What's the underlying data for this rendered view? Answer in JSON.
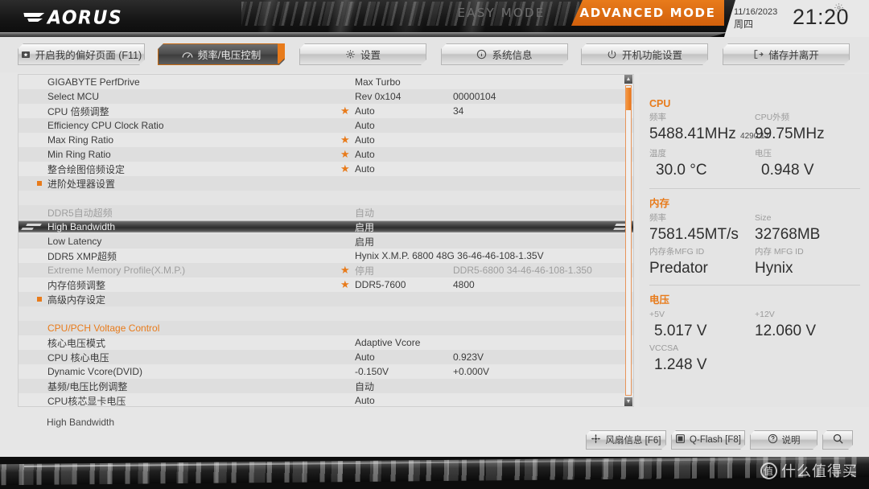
{
  "header": {
    "brand": "AORUS",
    "mode_easy": "EASY MODE",
    "mode_advanced": "ADVANCED MODE",
    "date": "11/16/2023",
    "weekday": "周四",
    "time": "21:20",
    "gear_icon": "gear-icon"
  },
  "tabs": [
    {
      "label": "开启我的偏好页面 (F11)",
      "icon": "favorite-page-icon",
      "active": false
    },
    {
      "label": "频率/电压控制",
      "icon": "tweaker-icon",
      "active": true
    },
    {
      "label": "设置",
      "icon": "gear-icon",
      "active": false
    },
    {
      "label": "系统信息",
      "icon": "info-icon",
      "active": false
    },
    {
      "label": "开机功能设置",
      "icon": "power-icon",
      "active": false
    },
    {
      "label": "储存并离开",
      "icon": "exit-icon",
      "active": false
    }
  ],
  "rows": [
    {
      "type": "item",
      "label": "GIGABYTE PerfDrive",
      "star": false,
      "value": "Max Turbo",
      "value2": "",
      "dim": false,
      "bullet": false
    },
    {
      "type": "item",
      "label": "Select MCU",
      "star": false,
      "value": "Rev 0x104",
      "value2": "00000104",
      "dim": false,
      "bullet": false
    },
    {
      "type": "item",
      "label": "CPU 倍频调整",
      "star": true,
      "value": "Auto",
      "value2": "34",
      "dim": false,
      "bullet": false
    },
    {
      "type": "item",
      "label": "Efficiency CPU Clock Ratio",
      "star": false,
      "value": "Auto",
      "value2": "",
      "dim": false,
      "bullet": false
    },
    {
      "type": "item",
      "label": "Max Ring Ratio",
      "star": true,
      "value": "Auto",
      "value2": "",
      "dim": false,
      "bullet": false
    },
    {
      "type": "item",
      "label": "Min Ring Ratio",
      "star": true,
      "value": "Auto",
      "value2": "",
      "dim": false,
      "bullet": false
    },
    {
      "type": "item",
      "label": "整合绘图倍频设定",
      "star": true,
      "value": "Auto",
      "value2": "",
      "dim": false,
      "bullet": false
    },
    {
      "type": "item",
      "label": "进阶处理器设置",
      "star": false,
      "value": "",
      "value2": "",
      "dim": false,
      "bullet": true
    },
    {
      "type": "spacer",
      "label": "",
      "star": false,
      "value": "",
      "value2": "",
      "dim": false,
      "bullet": false
    },
    {
      "type": "item",
      "label": "DDR5自动超频",
      "star": false,
      "value": "自动",
      "value2": "",
      "dim": true,
      "bullet": false
    },
    {
      "type": "selected",
      "label": "High Bandwidth",
      "star": false,
      "value": "启用",
      "value2": "",
      "dim": false,
      "bullet": false
    },
    {
      "type": "item",
      "label": "Low Latency",
      "star": false,
      "value": "启用",
      "value2": "",
      "dim": false,
      "bullet": false
    },
    {
      "type": "item",
      "label": "DDR5 XMP超频",
      "star": false,
      "value": "Hynix X.M.P. 6800 48G 36-46-46-108-1.35V",
      "value2": "",
      "dim": false,
      "bullet": false
    },
    {
      "type": "item",
      "label": "Extreme Memory Profile(X.M.P.)",
      "star": true,
      "value": "停用",
      "value2": "DDR5-6800 34-46-46-108-1.350",
      "dim": true,
      "bullet": false
    },
    {
      "type": "item",
      "label": "内存倍频调整",
      "star": true,
      "value": "DDR5-7600",
      "value2": "4800",
      "dim": false,
      "bullet": false
    },
    {
      "type": "item",
      "label": "高级内存设定",
      "star": false,
      "value": "",
      "value2": "",
      "dim": false,
      "bullet": true
    },
    {
      "type": "spacer",
      "label": "",
      "star": false,
      "value": "",
      "value2": "",
      "dim": false,
      "bullet": false
    },
    {
      "type": "section",
      "label": "CPU/PCH Voltage Control",
      "star": false,
      "value": "",
      "value2": "",
      "dim": false,
      "bullet": false
    },
    {
      "type": "item",
      "label": "核心电压模式",
      "star": false,
      "value": "Adaptive Vcore",
      "value2": "",
      "dim": false,
      "bullet": false
    },
    {
      "type": "item",
      "label": "CPU 核心电压",
      "star": false,
      "value": "Auto",
      "value2": "0.923V",
      "dim": false,
      "bullet": false
    },
    {
      "type": "item",
      "label": "Dynamic Vcore(DVID)",
      "star": false,
      "value": "-0.150V",
      "value2": "+0.000V",
      "dim": false,
      "bullet": false
    },
    {
      "type": "item",
      "label": "基频/电压比例调整",
      "star": false,
      "value": "自动",
      "value2": "",
      "dim": false,
      "bullet": false
    },
    {
      "type": "item",
      "label": "CPU核芯显卡电压",
      "star": false,
      "value": "Auto",
      "value2": "",
      "dim": false,
      "bullet": false
    }
  ],
  "right_panel": {
    "cpu": {
      "title": "CPU",
      "freq_caption": "频率",
      "freq_value": "5488.41MHz",
      "freq_sub": "4290.17",
      "bclk_caption": "CPU外频",
      "bclk_value": "99.75MHz",
      "temp_caption": "温度",
      "temp_value": "30.0 °C",
      "volt_caption": "电压",
      "volt_value": "0.948 V"
    },
    "memory": {
      "title": "内存",
      "freq_caption": "频率",
      "freq_value": "7581.45MT/s",
      "size_caption": "Size",
      "size_value": "32768MB",
      "module_mfg_caption": "内存条MFG ID",
      "module_mfg_value": "Predator",
      "dram_mfg_caption": "内存 MFG ID",
      "dram_mfg_value": "Hynix"
    },
    "voltage": {
      "title": "电压",
      "p5v_caption": "+5V",
      "p5v_value": "5.017 V",
      "p12v_caption": "+12V",
      "p12v_value": "12.060 V",
      "vccsa_caption": "VCCSA",
      "vccsa_value": "1.248 V"
    }
  },
  "status_bar": {
    "help_text": "High Bandwidth"
  },
  "bottom_buttons": [
    {
      "label": "风扇信息 [F6]",
      "icon": "fan-icon"
    },
    {
      "label": "Q-Flash [F8]",
      "icon": "qflash-icon"
    },
    {
      "label": "说明",
      "icon": "question-icon"
    },
    {
      "label": "",
      "icon": "search-icon"
    }
  ],
  "watermark": {
    "mark": "值",
    "text": "什么值得买"
  },
  "colors": {
    "accent": "#e87b1b",
    "bg": "#e4e4e4",
    "text": "#3c3c3c",
    "dim": "#9e9e9e"
  }
}
